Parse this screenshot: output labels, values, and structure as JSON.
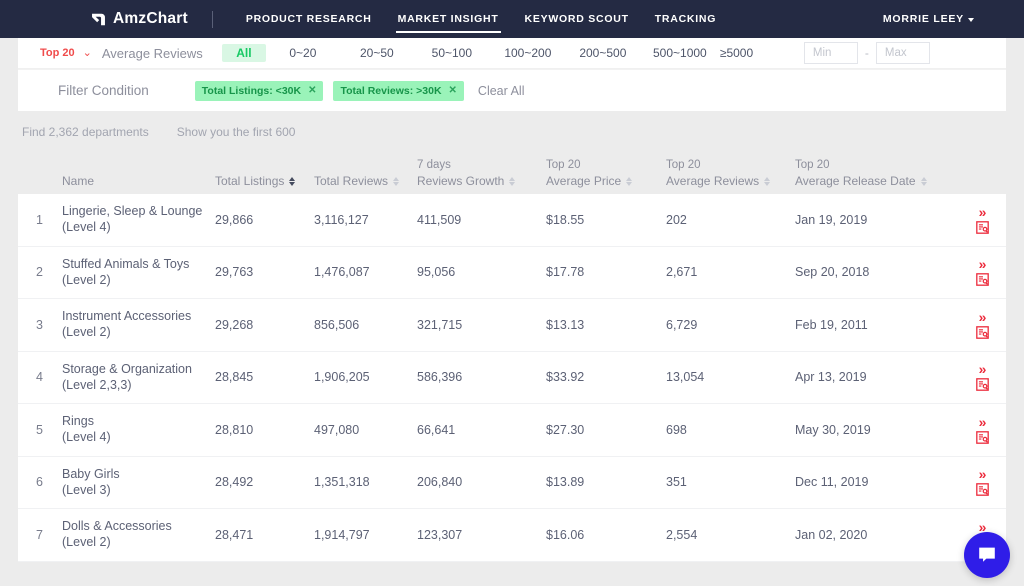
{
  "navbar": {
    "brand": "AmzChart",
    "brand_icon": "amzchart-logo-icon",
    "links": [
      {
        "label": "PRODUCT RESEARCH",
        "active": false
      },
      {
        "label": "MARKET INSIGHT",
        "active": true
      },
      {
        "label": "KEYWORD SCOUT",
        "active": false
      },
      {
        "label": "TRACKING",
        "active": false
      }
    ],
    "user": "MORRIE LEEY"
  },
  "filter": {
    "top_label": "Top 20",
    "chevron_icon": "chevron-down-icon",
    "metric_label": "Average Reviews",
    "ranges": [
      {
        "label": "All",
        "selected": true
      },
      {
        "label": "0~20",
        "selected": false
      },
      {
        "label": "20~50",
        "selected": false
      },
      {
        "label": "50~100",
        "selected": false
      },
      {
        "label": "100~200",
        "selected": false
      },
      {
        "label": "200~500",
        "selected": false
      },
      {
        "label": "500~1000",
        "selected": false
      },
      {
        "label": "≥5000",
        "selected": false
      }
    ],
    "min_placeholder": "Min",
    "min_value": "",
    "max_placeholder": "Max",
    "max_value": "",
    "dash": "-"
  },
  "condition": {
    "label": "Filter Condition",
    "tags": [
      {
        "text": "Total Listings: <30K",
        "remove_icon": "close-icon"
      },
      {
        "text": "Total Reviews: >30K",
        "remove_icon": "close-icon"
      }
    ],
    "clear_all": "Clear All"
  },
  "meta": {
    "found": "Find 2,362 departments",
    "shown": "Show you the first 600"
  },
  "table": {
    "columns": [
      {
        "sub": "",
        "label": "Name",
        "sortable": false,
        "active": false
      },
      {
        "sub": "",
        "label": "Total Listings",
        "sortable": true,
        "active": true
      },
      {
        "sub": "",
        "label": "Total Reviews",
        "sortable": true,
        "active": false
      },
      {
        "sub": "7 days",
        "label": "Reviews Growth",
        "sortable": true,
        "active": false
      },
      {
        "sub": "Top 20",
        "label": "Average Price",
        "sortable": true,
        "active": false
      },
      {
        "sub": "Top 20",
        "label": "Average Reviews",
        "sortable": true,
        "active": false
      },
      {
        "sub": "Top 20",
        "label": "Average Release Date",
        "sortable": true,
        "active": false
      }
    ],
    "rows": [
      {
        "index": "1",
        "name": "Lingerie, Sleep & Lounge",
        "level": "(Level 4)",
        "total_listings": "29,866",
        "total_reviews": "3,116,127",
        "reviews_growth": "411,509",
        "average_price": "$18.55",
        "average_reviews": "202",
        "average_release_date": "Jan 19, 2019"
      },
      {
        "index": "2",
        "name": "Stuffed Animals & Toys",
        "level": "(Level 2)",
        "total_listings": "29,763",
        "total_reviews": "1,476,087",
        "reviews_growth": "95,056",
        "average_price": "$17.78",
        "average_reviews": "2,671",
        "average_release_date": "Sep 20, 2018"
      },
      {
        "index": "3",
        "name": "Instrument Accessories",
        "level": "(Level 2)",
        "total_listings": "29,268",
        "total_reviews": "856,506",
        "reviews_growth": "321,715",
        "average_price": "$13.13",
        "average_reviews": "6,729",
        "average_release_date": "Feb 19, 2011"
      },
      {
        "index": "4",
        "name": "Storage & Organization",
        "level": "(Level 2,3,3)",
        "total_listings": "28,845",
        "total_reviews": "1,906,205",
        "reviews_growth": "586,396",
        "average_price": "$33.92",
        "average_reviews": "13,054",
        "average_release_date": "Apr 13, 2019"
      },
      {
        "index": "5",
        "name": "Rings",
        "level": "(Level 4)",
        "total_listings": "28,810",
        "total_reviews": "497,080",
        "reviews_growth": "66,641",
        "average_price": "$27.30",
        "average_reviews": "698",
        "average_release_date": "May 30, 2019"
      },
      {
        "index": "6",
        "name": "Baby Girls",
        "level": "(Level 3)",
        "total_listings": "28,492",
        "total_reviews": "1,351,318",
        "reviews_growth": "206,840",
        "average_price": "$13.89",
        "average_reviews": "351",
        "average_release_date": "Dec 11, 2019"
      },
      {
        "index": "7",
        "name": "Dolls & Accessories",
        "level": "(Level 2)",
        "total_listings": "28,471",
        "total_reviews": "1,914,797",
        "reviews_growth": "123,307",
        "average_price": "$16.06",
        "average_reviews": "2,554",
        "average_release_date": "Jan 02, 2020"
      }
    ],
    "row_actions": {
      "expand_icon": "double-chevron-right-icon",
      "expand_glyph": "»",
      "report_icon": "document-search-icon"
    }
  },
  "chat": {
    "icon": "chat-bubble-icon"
  },
  "colors": {
    "nav_bg": "#242a43",
    "accent_red": "#f04b4b",
    "tag_green_bg": "#9af3b9",
    "tag_green_text": "#17954a",
    "action_red": "#ec2b3c",
    "chat_blue": "#2f1de8",
    "page_bg": "#ececec"
  }
}
